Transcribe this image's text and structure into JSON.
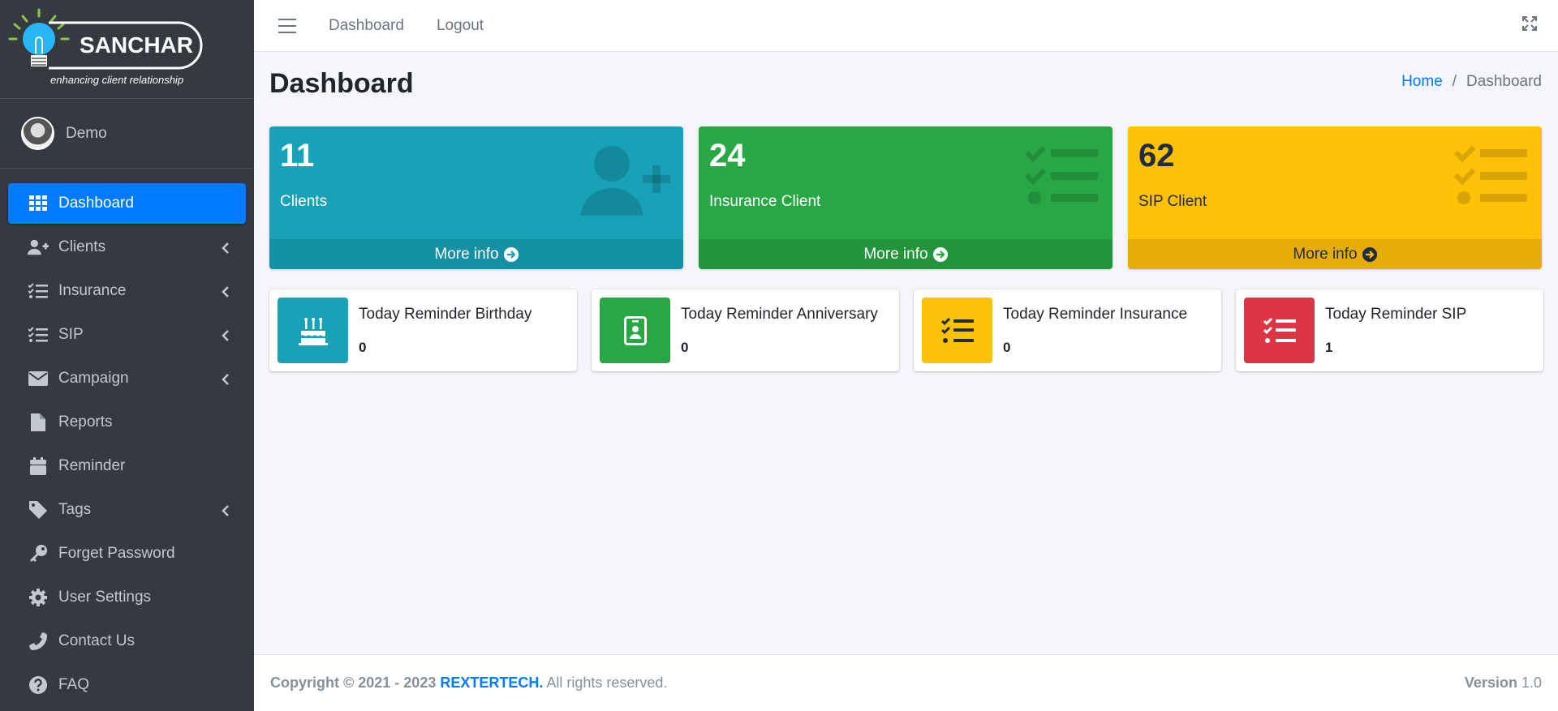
{
  "brand": {
    "name": "SANCHAR",
    "tagline": "enhancing client relationship"
  },
  "user": {
    "name": "Demo"
  },
  "sidebar": {
    "items": [
      {
        "label": "Dashboard",
        "icon": "grid-icon",
        "active": true
      },
      {
        "label": "Clients",
        "icon": "user-plus-icon",
        "has_children": true
      },
      {
        "label": "Insurance",
        "icon": "list-check-icon",
        "has_children": true
      },
      {
        "label": "SIP",
        "icon": "list-check-icon",
        "has_children": true
      },
      {
        "label": "Campaign",
        "icon": "envelope-icon",
        "has_children": true
      },
      {
        "label": "Reports",
        "icon": "file-icon"
      },
      {
        "label": "Reminder",
        "icon": "calendar-icon"
      },
      {
        "label": "Tags",
        "icon": "tag-icon",
        "has_children": true
      },
      {
        "label": "Forget Password",
        "icon": "key-icon"
      },
      {
        "label": "User Settings",
        "icon": "gear-icon"
      },
      {
        "label": "Contact Us",
        "icon": "phone-icon"
      },
      {
        "label": "FAQ",
        "icon": "question-icon"
      }
    ]
  },
  "topbar": {
    "links": [
      "Dashboard",
      "Logout"
    ]
  },
  "page": {
    "title": "Dashboard"
  },
  "breadcrumb": {
    "home": "Home",
    "current": "Dashboard"
  },
  "stats": [
    {
      "value": "11",
      "label": "Clients",
      "footer": "More info",
      "color": "#17a2b8"
    },
    {
      "value": "24",
      "label": "Insurance Client",
      "footer": "More info",
      "color": "#28a745"
    },
    {
      "value": "62",
      "label": "SIP Client",
      "footer": "More info",
      "color": "#ffc107"
    }
  ],
  "reminders": [
    {
      "title": "Today Reminder Birthday",
      "value": "0",
      "color": "#17a2b8",
      "icon": "birthday-cake-icon"
    },
    {
      "title": "Today Reminder Anniversary",
      "value": "0",
      "color": "#28a745",
      "icon": "id-badge-icon"
    },
    {
      "title": "Today Reminder Insurance",
      "value": "0",
      "color": "#ffc107",
      "icon": "list-check-icon"
    },
    {
      "title": "Today Reminder SIP",
      "value": "1",
      "color": "#dc3545",
      "icon": "list-check-icon"
    }
  ],
  "footer": {
    "copyright": "Copyright © 2021 - 2023",
    "company": "REXTERTECH.",
    "rights": "All rights reserved.",
    "version_label": "Version",
    "version": "1.0"
  }
}
